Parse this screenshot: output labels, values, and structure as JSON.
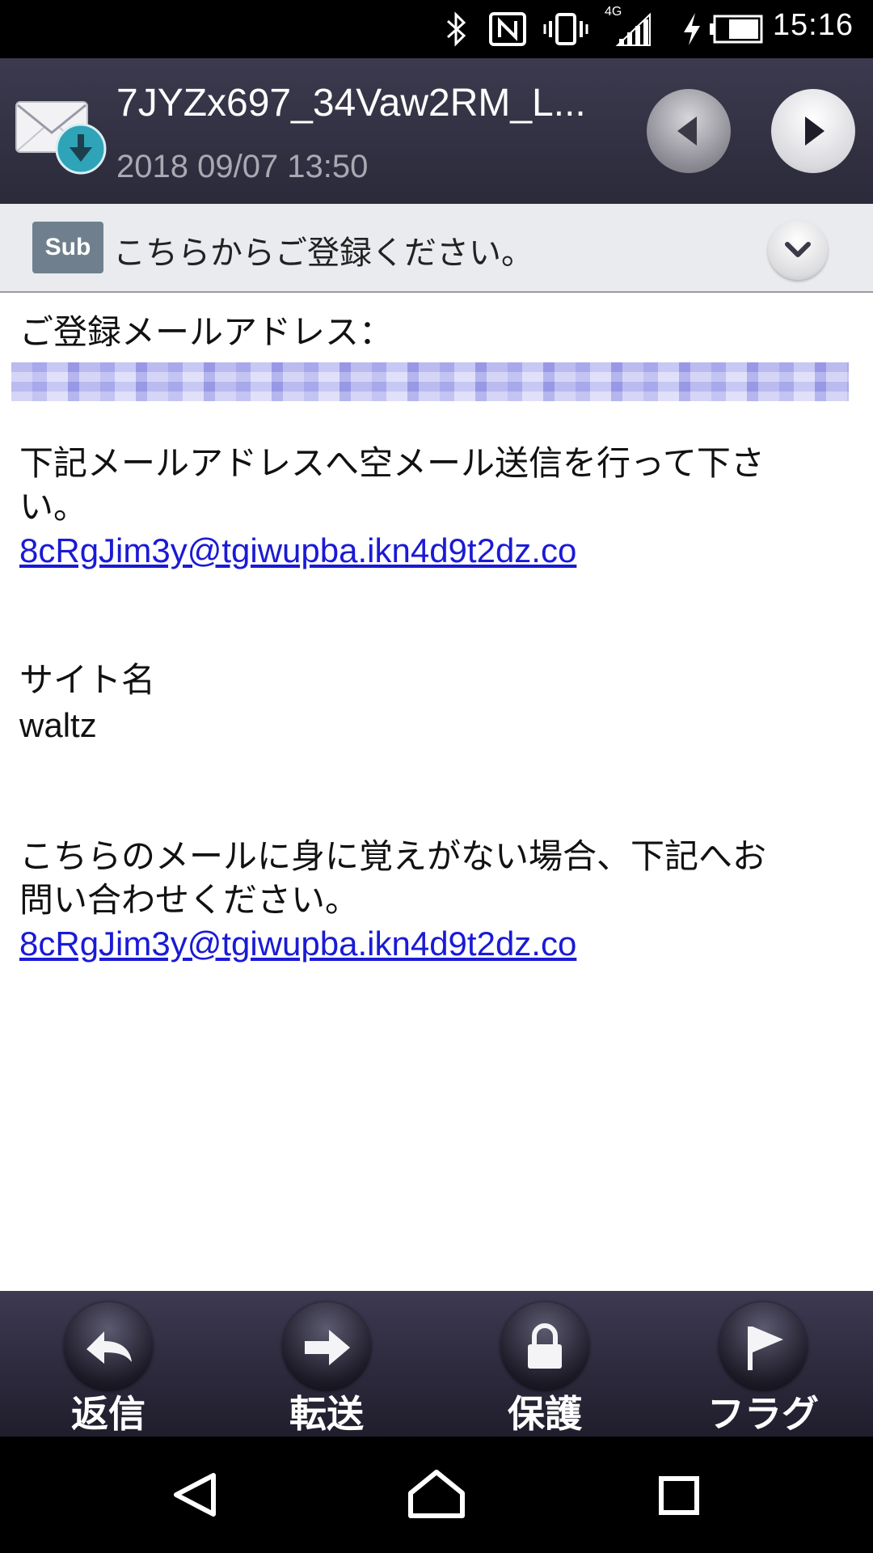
{
  "status_bar": {
    "network_label": "4G",
    "time": "15:16",
    "icons": [
      "bluetooth-icon",
      "nfc-icon",
      "vibrate-icon",
      "signal-icon",
      "charging-icon",
      "battery-icon"
    ]
  },
  "header": {
    "title": "7JYZx697_34Vaw2RM_L...",
    "date": "2018 09/07 13:50"
  },
  "subject_bar": {
    "badge": "Sub",
    "subject": "こちらからご登録ください。"
  },
  "body": {
    "registered_label": "ご登録メールアドレス：",
    "instruction_line1": "下記メールアドレスへ空メール送信を行って下さ",
    "instruction_line2": "い。",
    "link1": "8cRgJim3y@tgiwupba.ikn4d9t2dz.co",
    "site_label": "サイト名",
    "site_value": "waltz",
    "contact_line1": "こちらのメールに身に覚えがない場合、下記へお",
    "contact_line2": "問い合わせください。",
    "link2": "8cRgJim3y@tgiwupba.ikn4d9t2dz.co"
  },
  "toolbar": {
    "reply": "返信",
    "forward": "転送",
    "protect": "保護",
    "flag": "フラグ"
  },
  "colors": {
    "header_bg": "#34324a",
    "link": "#1a1ad6",
    "subject_bar_bg": "#e9ebee"
  }
}
